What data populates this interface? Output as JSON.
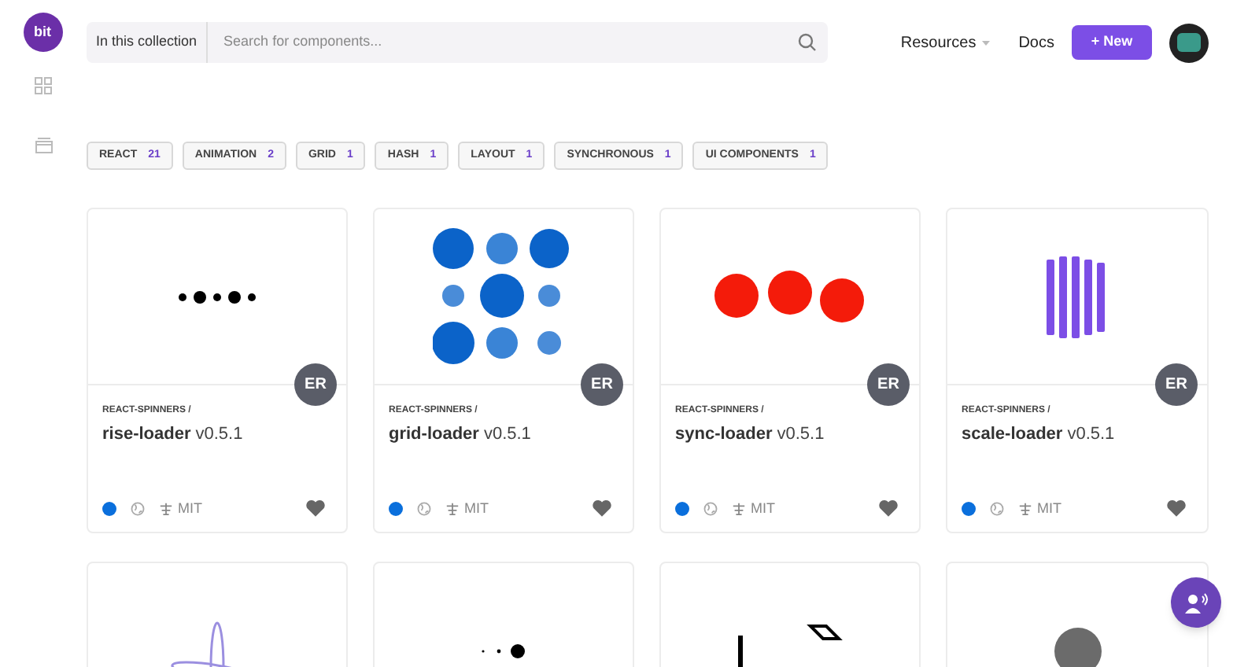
{
  "logo": {
    "text": "bit"
  },
  "header": {
    "scope_label": "In this collection",
    "search": {
      "placeholder": "Search for components..."
    },
    "nav": [
      {
        "kind": "dropdown",
        "label": "Resources"
      },
      {
        "kind": "link",
        "label": "Docs"
      }
    ],
    "new_button": "+ New"
  },
  "tags": [
    {
      "label": "REACT",
      "count": "21"
    },
    {
      "label": "ANIMATION",
      "count": "2"
    },
    {
      "label": "GRID",
      "count": "1"
    },
    {
      "label": "HASH",
      "count": "1"
    },
    {
      "label": "LAYOUT",
      "count": "1"
    },
    {
      "label": "SYNCHRONOUS",
      "count": "1"
    },
    {
      "label": "UI COMPONENTS",
      "count": "1"
    }
  ],
  "cards": [
    {
      "kind": "rise",
      "scope": "REACT-SPINNERS /",
      "name": "rise-loader",
      "version": "v0.5.1",
      "license": "MIT",
      "author": "ER"
    },
    {
      "kind": "grid",
      "scope": "REACT-SPINNERS /",
      "name": "grid-loader",
      "version": "v0.5.1",
      "license": "MIT",
      "author": "ER"
    },
    {
      "kind": "sync",
      "scope": "REACT-SPINNERS /",
      "name": "sync-loader",
      "version": "v0.5.1",
      "license": "MIT",
      "author": "ER"
    },
    {
      "kind": "scale",
      "scope": "REACT-SPINNERS /",
      "name": "scale-loader",
      "version": "v0.5.1",
      "license": "MIT",
      "author": "ER"
    },
    {
      "kind": "ring"
    },
    {
      "kind": "dots"
    },
    {
      "kind": "bars"
    },
    {
      "kind": "circle"
    }
  ]
}
